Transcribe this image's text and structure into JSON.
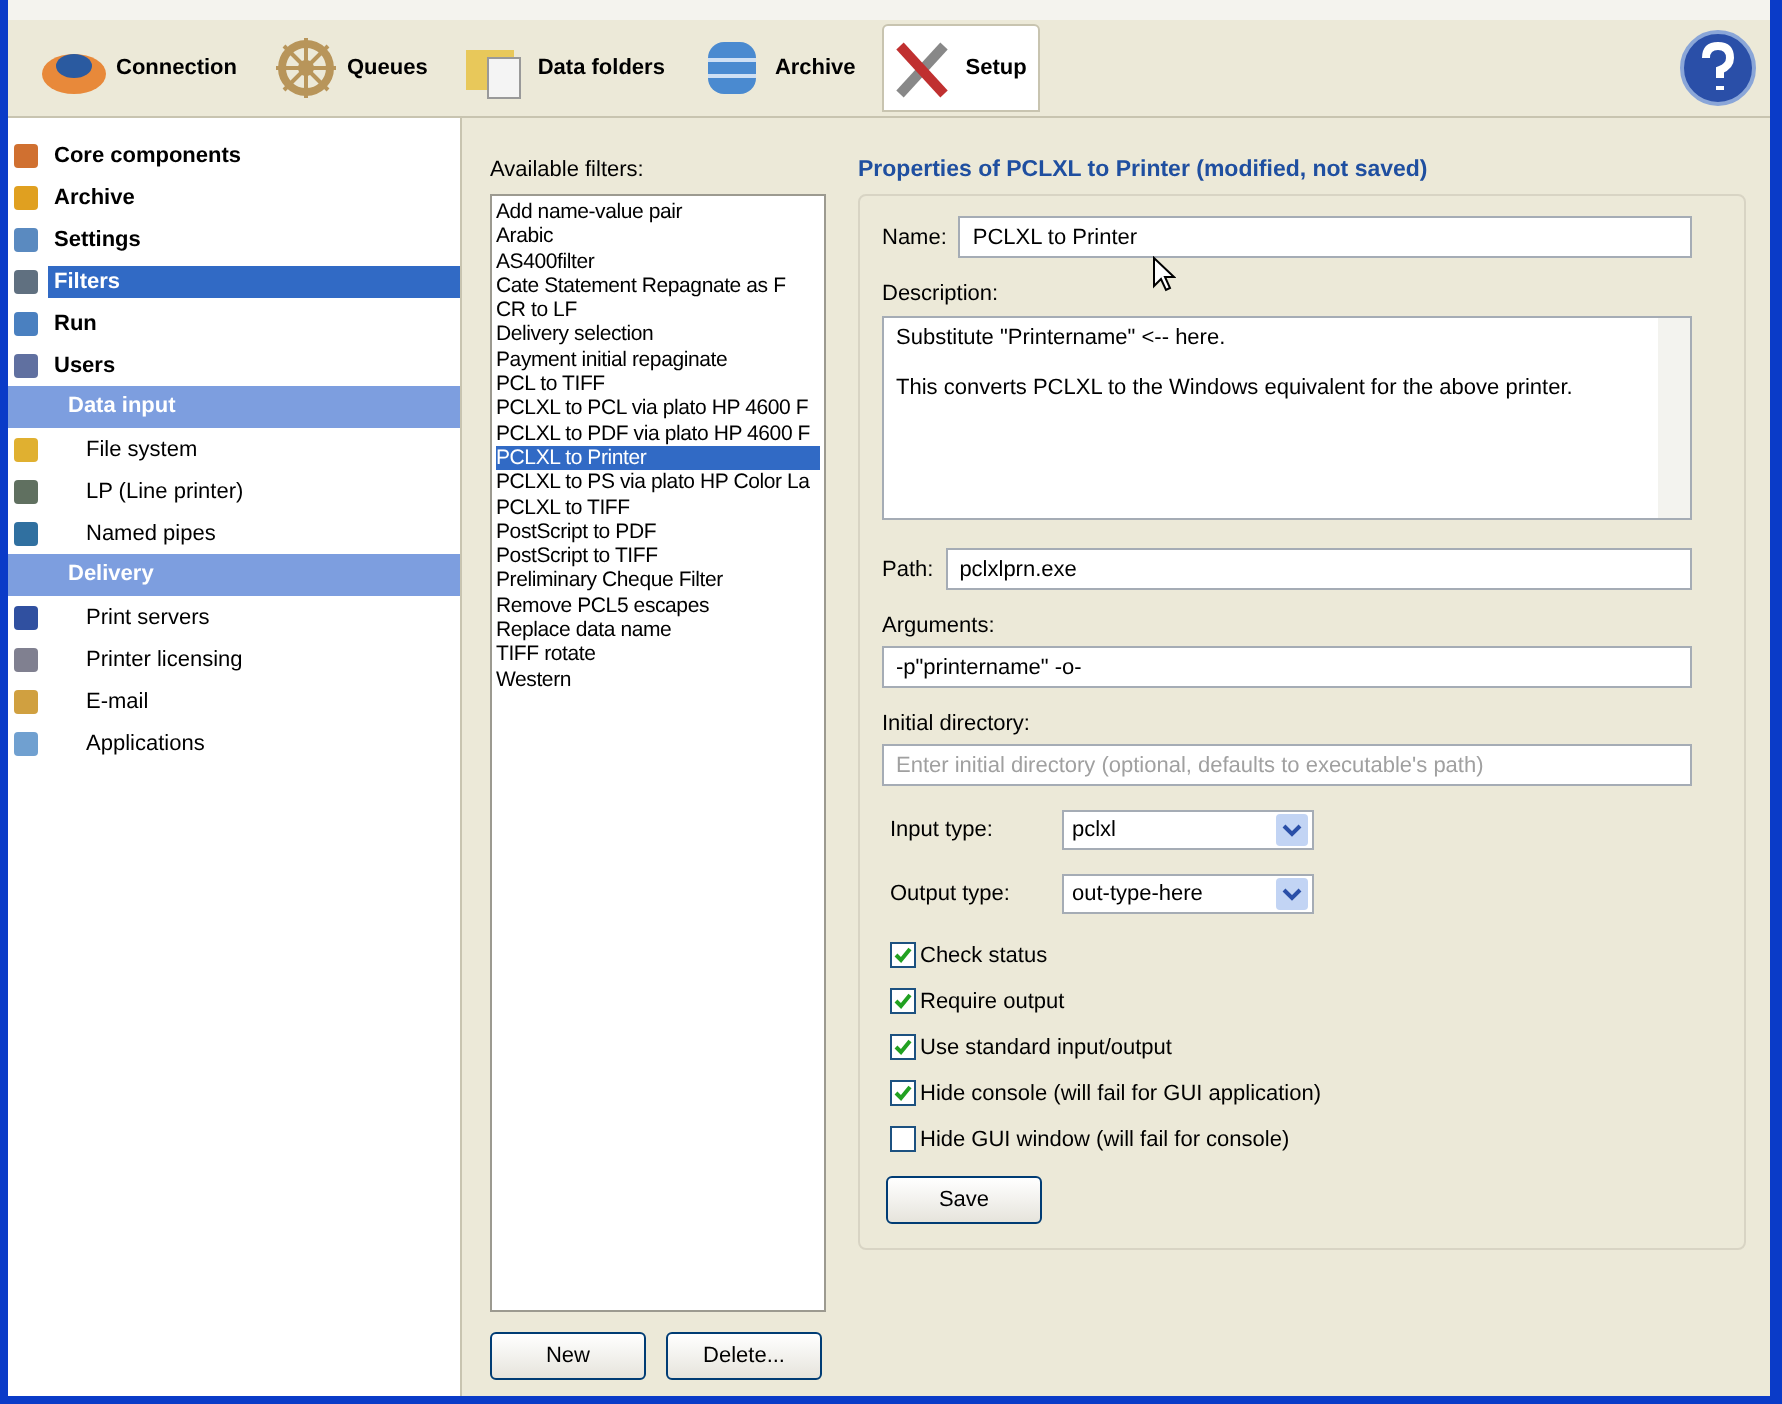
{
  "toolbar": {
    "tabs": [
      {
        "label": "Connection",
        "selected": false
      },
      {
        "label": "Queues",
        "selected": false
      },
      {
        "label": "Data folders",
        "selected": false
      },
      {
        "label": "Archive",
        "selected": false
      },
      {
        "label": "Setup",
        "selected": true
      }
    ]
  },
  "sidebar": {
    "items": [
      {
        "kind": "main",
        "label": "Core components",
        "selected": false
      },
      {
        "kind": "main",
        "label": "Archive",
        "selected": false
      },
      {
        "kind": "main",
        "label": "Settings",
        "selected": false
      },
      {
        "kind": "main",
        "label": "Filters",
        "selected": true
      },
      {
        "kind": "main",
        "label": "Run",
        "selected": false
      },
      {
        "kind": "main",
        "label": "Users",
        "selected": false
      },
      {
        "kind": "header",
        "label": "Data input"
      },
      {
        "kind": "sub",
        "label": "File system",
        "selected": false
      },
      {
        "kind": "sub",
        "label": "LP (Line printer)",
        "selected": false
      },
      {
        "kind": "sub",
        "label": "Named pipes",
        "selected": false
      },
      {
        "kind": "header",
        "label": "Delivery"
      },
      {
        "kind": "sub",
        "label": "Print servers",
        "selected": false
      },
      {
        "kind": "sub",
        "label": "Printer licensing",
        "selected": false
      },
      {
        "kind": "sub",
        "label": "E-mail",
        "selected": false
      },
      {
        "kind": "sub",
        "label": "Applications",
        "selected": false
      }
    ]
  },
  "filters": {
    "label": "Available filters:",
    "items": [
      {
        "label": "Add name-value pair",
        "selected": false
      },
      {
        "label": "Arabic",
        "selected": false
      },
      {
        "label": "AS400filter",
        "selected": false
      },
      {
        "label": "Cate Statement Repagnate as F",
        "selected": false
      },
      {
        "label": "CR to LF",
        "selected": false
      },
      {
        "label": "Delivery selection",
        "selected": false
      },
      {
        "label": "Payment initial repaginate",
        "selected": false
      },
      {
        "label": "PCL to TIFF",
        "selected": false
      },
      {
        "label": "PCLXL to PCL via plato HP 4600 F",
        "selected": false
      },
      {
        "label": "PCLXL to PDF via plato HP 4600 F",
        "selected": false
      },
      {
        "label": "PCLXL to Printer",
        "selected": true
      },
      {
        "label": "PCLXL to PS via plato HP Color La",
        "selected": false
      },
      {
        "label": "PCLXL to TIFF",
        "selected": false
      },
      {
        "label": "PostScript to PDF",
        "selected": false
      },
      {
        "label": "PostScript to TIFF",
        "selected": false
      },
      {
        "label": "Preliminary Cheque Filter",
        "selected": false
      },
      {
        "label": "Remove PCL5 escapes",
        "selected": false
      },
      {
        "label": "Replace data name",
        "selected": false
      },
      {
        "label": "TIFF rotate",
        "selected": false
      },
      {
        "label": "Western",
        "selected": false
      }
    ],
    "buttons": [
      "New",
      "Delete..."
    ]
  },
  "properties": {
    "title": "Properties of PCLXL to Printer (modified, not saved)",
    "name": {
      "label": "Name:",
      "value": "PCLXL to Printer"
    },
    "description": {
      "label": "Description:",
      "paragraphs": [
        "Substitute \"Printername\" <-- here.",
        "This converts PCLXL to the Windows equivalent for the above printer."
      ]
    },
    "path": {
      "label": "Path:",
      "value": "pclxlprn.exe"
    },
    "arguments": {
      "label": "Arguments:",
      "value": "-p\"printername\" -o-"
    },
    "initial_directory": {
      "label": "Initial directory:",
      "placeholder": "Enter initial directory (optional, defaults to executable's path)"
    },
    "dropdowns": [
      {
        "label": "Input type:",
        "value": "pclxl"
      },
      {
        "label": "Output type:",
        "value": "out-type-here"
      }
    ],
    "checkboxes": [
      {
        "label": "Check status",
        "checked": true
      },
      {
        "label": "Require output",
        "checked": true
      },
      {
        "label": "Use standard input/output",
        "checked": true
      },
      {
        "label": "Hide console (will fail for GUI application)",
        "checked": true
      },
      {
        "label": "Hide GUI window (will fail for console)",
        "checked": false
      }
    ],
    "save_button": "Save"
  }
}
